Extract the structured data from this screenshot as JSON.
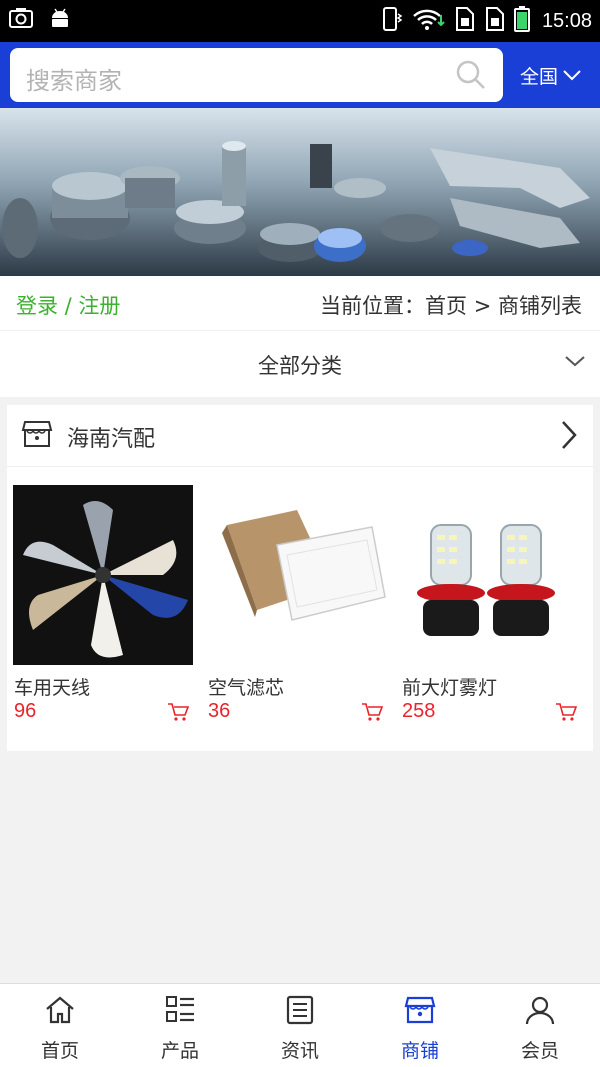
{
  "status_bar": {
    "time": "15:08"
  },
  "search": {
    "placeholder": "搜索商家",
    "region": "全国"
  },
  "breadcrumb": {
    "login_register": "登录 / 注册",
    "location": "当前位置：首页 > 商铺列表"
  },
  "category": {
    "label": "全部分类"
  },
  "store": {
    "name": "海南汽配",
    "products": [
      {
        "name": "车用天线",
        "price": "96"
      },
      {
        "name": "空气滤芯",
        "price": "36"
      },
      {
        "name": "前大灯雾灯",
        "price": "258"
      }
    ]
  },
  "tabs": [
    {
      "label": "首页",
      "icon": "home-icon",
      "active": false
    },
    {
      "label": "产品",
      "icon": "grid-list-icon",
      "active": false
    },
    {
      "label": "资讯",
      "icon": "news-icon",
      "active": false
    },
    {
      "label": "商铺",
      "icon": "store-icon",
      "active": true
    },
    {
      "label": "会员",
      "icon": "user-icon",
      "active": false
    }
  ],
  "colors": {
    "brand": "#1a3fd6",
    "price": "#e8242a",
    "login": "#3cb02f"
  }
}
